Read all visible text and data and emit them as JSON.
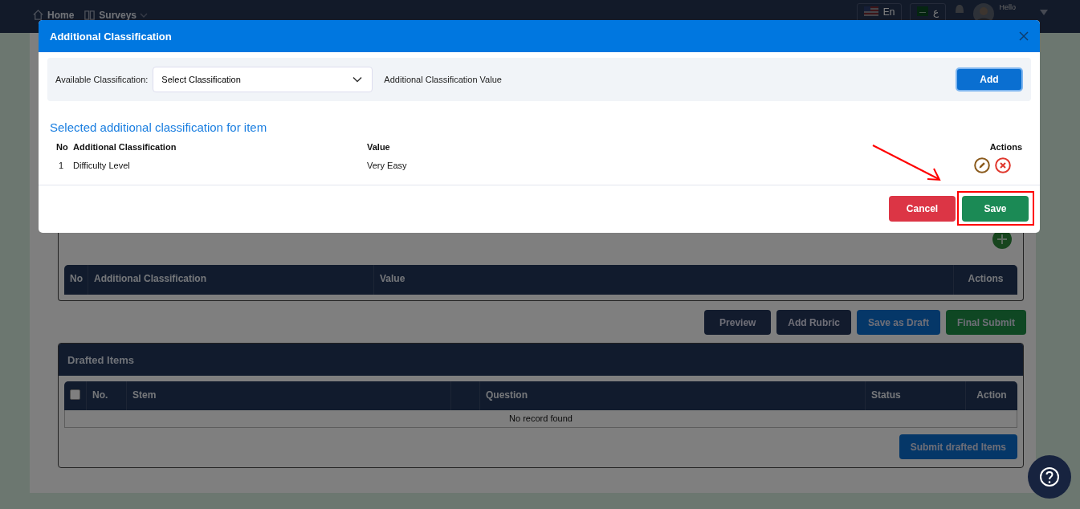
{
  "topbar": {
    "nav": [
      {
        "label": "Home",
        "kind": "home"
      },
      {
        "label": "Surveys",
        "kind": "book"
      }
    ],
    "language": "En",
    "second_language": "ع",
    "greeting": "Hello"
  },
  "page": {
    "classification_columns": [
      "No",
      "Additional Classification",
      "Value",
      "Actions"
    ],
    "actions": [
      {
        "label": "Preview",
        "kind": "dark"
      },
      {
        "label": "Add Rubric",
        "kind": "dark"
      },
      {
        "label": "Save as Draft",
        "kind": "blue"
      },
      {
        "label": "Final Submit",
        "kind": "green"
      }
    ],
    "drafted": {
      "title": "Drafted Items",
      "select_all": {
        "checked": false
      },
      "columns": [
        "No.",
        "Stem",
        "Question",
        "Status",
        "Action"
      ],
      "empty": "No record found",
      "submit": "Submit drafted Items"
    }
  },
  "dialog": {
    "title": "Additional Classification",
    "filter_label": "Available Classification:",
    "select_placeholder": "Select Classification",
    "value_label": "Additional Classification Value",
    "add": "Add",
    "section_title": "Selected additional classification for item",
    "columns": [
      "No",
      "Additional Classification",
      "Value",
      "Actions"
    ],
    "rows": [
      {
        "no": "1",
        "classification": "Difficulty Level",
        "value": "Very Easy"
      }
    ],
    "cancel": "Cancel",
    "save": "Save"
  }
}
